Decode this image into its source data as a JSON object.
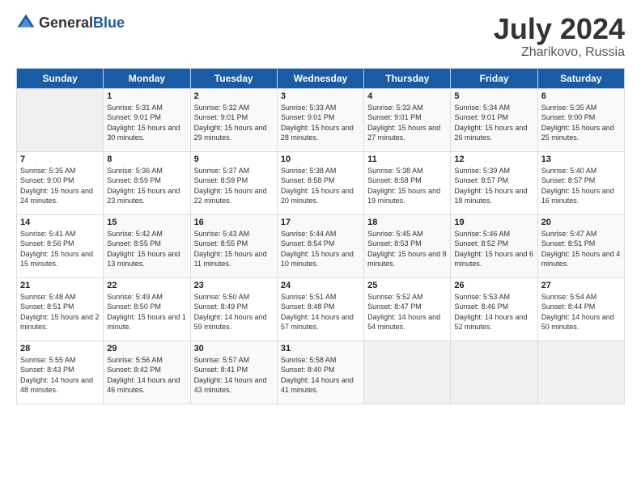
{
  "logo": {
    "general": "General",
    "blue": "Blue"
  },
  "title": {
    "month_year": "July 2024",
    "location": "Zharikovo, Russia"
  },
  "headers": [
    "Sunday",
    "Monday",
    "Tuesday",
    "Wednesday",
    "Thursday",
    "Friday",
    "Saturday"
  ],
  "weeks": [
    [
      {
        "day": "",
        "sunrise": "",
        "sunset": "",
        "daylight": ""
      },
      {
        "day": "1",
        "sunrise": "Sunrise: 5:31 AM",
        "sunset": "Sunset: 9:01 PM",
        "daylight": "Daylight: 15 hours and 30 minutes."
      },
      {
        "day": "2",
        "sunrise": "Sunrise: 5:32 AM",
        "sunset": "Sunset: 9:01 PM",
        "daylight": "Daylight: 15 hours and 29 minutes."
      },
      {
        "day": "3",
        "sunrise": "Sunrise: 5:33 AM",
        "sunset": "Sunset: 9:01 PM",
        "daylight": "Daylight: 15 hours and 28 minutes."
      },
      {
        "day": "4",
        "sunrise": "Sunrise: 5:33 AM",
        "sunset": "Sunset: 9:01 PM",
        "daylight": "Daylight: 15 hours and 27 minutes."
      },
      {
        "day": "5",
        "sunrise": "Sunrise: 5:34 AM",
        "sunset": "Sunset: 9:01 PM",
        "daylight": "Daylight: 15 hours and 26 minutes."
      },
      {
        "day": "6",
        "sunrise": "Sunrise: 5:35 AM",
        "sunset": "Sunset: 9:00 PM",
        "daylight": "Daylight: 15 hours and 25 minutes."
      }
    ],
    [
      {
        "day": "7",
        "sunrise": "Sunrise: 5:35 AM",
        "sunset": "Sunset: 9:00 PM",
        "daylight": "Daylight: 15 hours and 24 minutes."
      },
      {
        "day": "8",
        "sunrise": "Sunrise: 5:36 AM",
        "sunset": "Sunset: 8:59 PM",
        "daylight": "Daylight: 15 hours and 23 minutes."
      },
      {
        "day": "9",
        "sunrise": "Sunrise: 5:37 AM",
        "sunset": "Sunset: 8:59 PM",
        "daylight": "Daylight: 15 hours and 22 minutes."
      },
      {
        "day": "10",
        "sunrise": "Sunrise: 5:38 AM",
        "sunset": "Sunset: 8:58 PM",
        "daylight": "Daylight: 15 hours and 20 minutes."
      },
      {
        "day": "11",
        "sunrise": "Sunrise: 5:38 AM",
        "sunset": "Sunset: 8:58 PM",
        "daylight": "Daylight: 15 hours and 19 minutes."
      },
      {
        "day": "12",
        "sunrise": "Sunrise: 5:39 AM",
        "sunset": "Sunset: 8:57 PM",
        "daylight": "Daylight: 15 hours and 18 minutes."
      },
      {
        "day": "13",
        "sunrise": "Sunrise: 5:40 AM",
        "sunset": "Sunset: 8:57 PM",
        "daylight": "Daylight: 15 hours and 16 minutes."
      }
    ],
    [
      {
        "day": "14",
        "sunrise": "Sunrise: 5:41 AM",
        "sunset": "Sunset: 8:56 PM",
        "daylight": "Daylight: 15 hours and 15 minutes."
      },
      {
        "day": "15",
        "sunrise": "Sunrise: 5:42 AM",
        "sunset": "Sunset: 8:55 PM",
        "daylight": "Daylight: 15 hours and 13 minutes."
      },
      {
        "day": "16",
        "sunrise": "Sunrise: 5:43 AM",
        "sunset": "Sunset: 8:55 PM",
        "daylight": "Daylight: 15 hours and 11 minutes."
      },
      {
        "day": "17",
        "sunrise": "Sunrise: 5:44 AM",
        "sunset": "Sunset: 8:54 PM",
        "daylight": "Daylight: 15 hours and 10 minutes."
      },
      {
        "day": "18",
        "sunrise": "Sunrise: 5:45 AM",
        "sunset": "Sunset: 8:53 PM",
        "daylight": "Daylight: 15 hours and 8 minutes."
      },
      {
        "day": "19",
        "sunrise": "Sunrise: 5:46 AM",
        "sunset": "Sunset: 8:52 PM",
        "daylight": "Daylight: 15 hours and 6 minutes."
      },
      {
        "day": "20",
        "sunrise": "Sunrise: 5:47 AM",
        "sunset": "Sunset: 8:51 PM",
        "daylight": "Daylight: 15 hours and 4 minutes."
      }
    ],
    [
      {
        "day": "21",
        "sunrise": "Sunrise: 5:48 AM",
        "sunset": "Sunset: 8:51 PM",
        "daylight": "Daylight: 15 hours and 2 minutes."
      },
      {
        "day": "22",
        "sunrise": "Sunrise: 5:49 AM",
        "sunset": "Sunset: 8:50 PM",
        "daylight": "Daylight: 15 hours and 1 minute."
      },
      {
        "day": "23",
        "sunrise": "Sunrise: 5:50 AM",
        "sunset": "Sunset: 8:49 PM",
        "daylight": "Daylight: 14 hours and 59 minutes."
      },
      {
        "day": "24",
        "sunrise": "Sunrise: 5:51 AM",
        "sunset": "Sunset: 8:48 PM",
        "daylight": "Daylight: 14 hours and 57 minutes."
      },
      {
        "day": "25",
        "sunrise": "Sunrise: 5:52 AM",
        "sunset": "Sunset: 8:47 PM",
        "daylight": "Daylight: 14 hours and 54 minutes."
      },
      {
        "day": "26",
        "sunrise": "Sunrise: 5:53 AM",
        "sunset": "Sunset: 8:46 PM",
        "daylight": "Daylight: 14 hours and 52 minutes."
      },
      {
        "day": "27",
        "sunrise": "Sunrise: 5:54 AM",
        "sunset": "Sunset: 8:44 PM",
        "daylight": "Daylight: 14 hours and 50 minutes."
      }
    ],
    [
      {
        "day": "28",
        "sunrise": "Sunrise: 5:55 AM",
        "sunset": "Sunset: 8:43 PM",
        "daylight": "Daylight: 14 hours and 48 minutes."
      },
      {
        "day": "29",
        "sunrise": "Sunrise: 5:56 AM",
        "sunset": "Sunset: 8:42 PM",
        "daylight": "Daylight: 14 hours and 46 minutes."
      },
      {
        "day": "30",
        "sunrise": "Sunrise: 5:57 AM",
        "sunset": "Sunset: 8:41 PM",
        "daylight": "Daylight: 14 hours and 43 minutes."
      },
      {
        "day": "31",
        "sunrise": "Sunrise: 5:58 AM",
        "sunset": "Sunset: 8:40 PM",
        "daylight": "Daylight: 14 hours and 41 minutes."
      },
      {
        "day": "",
        "sunrise": "",
        "sunset": "",
        "daylight": ""
      },
      {
        "day": "",
        "sunrise": "",
        "sunset": "",
        "daylight": ""
      },
      {
        "day": "",
        "sunrise": "",
        "sunset": "",
        "daylight": ""
      }
    ]
  ]
}
